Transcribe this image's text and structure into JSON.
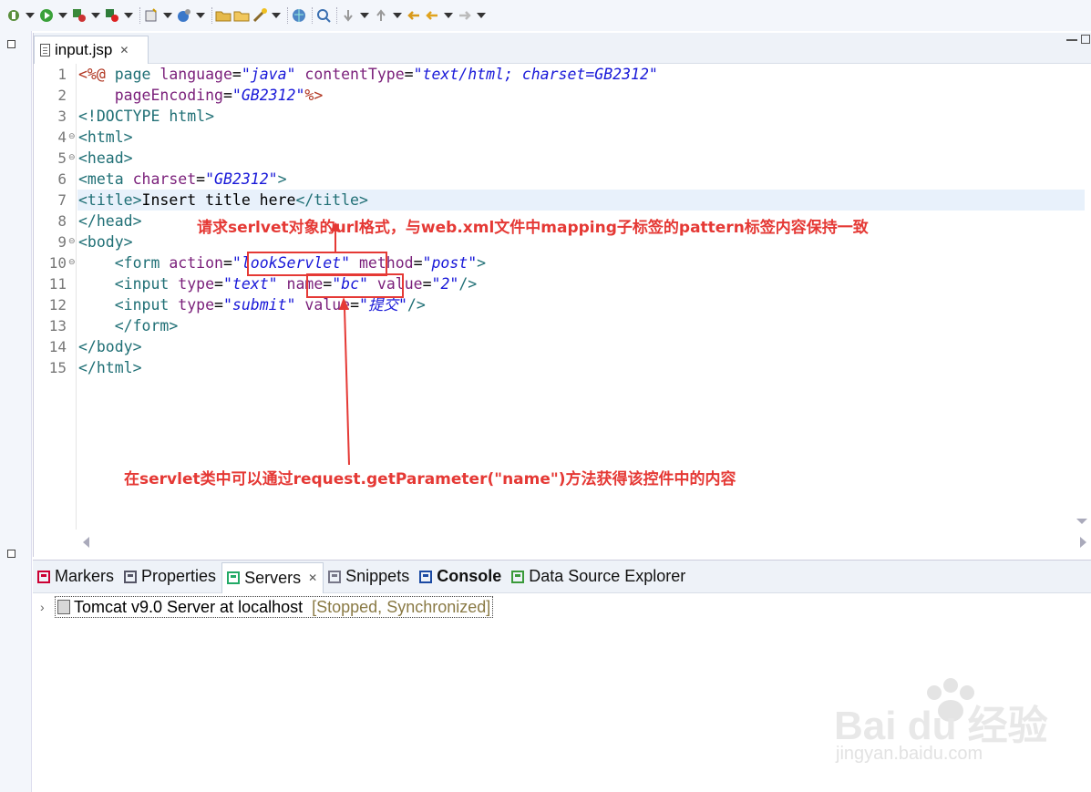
{
  "editor": {
    "tab_label": "input.jsp",
    "lines": [
      {
        "n": "1",
        "tokens": [
          {
            "c": "dl",
            "t": "<%@ "
          },
          {
            "c": "tg",
            "t": "page "
          },
          {
            "c": "an",
            "t": "language"
          },
          {
            "c": "tx",
            "t": "="
          },
          {
            "c": "av",
            "t": "\"java\""
          },
          {
            "c": "tx",
            "t": " "
          },
          {
            "c": "an",
            "t": "contentType"
          },
          {
            "c": "tx",
            "t": "="
          },
          {
            "c": "av",
            "t": "\"text/html; charset=GB2312\""
          }
        ]
      },
      {
        "n": "2",
        "tokens": [
          {
            "c": "tx",
            "t": "    "
          },
          {
            "c": "an",
            "t": "pageEncoding"
          },
          {
            "c": "tx",
            "t": "="
          },
          {
            "c": "av",
            "t": "\"GB2312\""
          },
          {
            "c": "dl",
            "t": "%>"
          }
        ]
      },
      {
        "n": "3",
        "tokens": [
          {
            "c": "tg",
            "t": "<!DOCTYPE "
          },
          {
            "c": "tg",
            "t": "html>"
          }
        ]
      },
      {
        "n": "4",
        "fold": true,
        "tokens": [
          {
            "c": "tg",
            "t": "<html>"
          }
        ]
      },
      {
        "n": "5",
        "fold": true,
        "tokens": [
          {
            "c": "tg",
            "t": "<head>"
          }
        ]
      },
      {
        "n": "6",
        "tokens": [
          {
            "c": "tg",
            "t": "<meta "
          },
          {
            "c": "an",
            "t": "charset"
          },
          {
            "c": "tx",
            "t": "="
          },
          {
            "c": "av",
            "t": "\"GB2312\""
          },
          {
            "c": "tg",
            "t": ">"
          }
        ]
      },
      {
        "n": "7",
        "tokens": [
          {
            "c": "tg",
            "t": "<title>"
          },
          {
            "c": "tx",
            "t": "Insert title here"
          },
          {
            "c": "tg",
            "t": "</title>"
          }
        ]
      },
      {
        "n": "8",
        "tokens": [
          {
            "c": "tg",
            "t": "</head>"
          }
        ]
      },
      {
        "n": "9",
        "fold": true,
        "tokens": [
          {
            "c": "tg",
            "t": "<body>"
          }
        ]
      },
      {
        "n": "10",
        "fold": true,
        "tokens": [
          {
            "c": "tx",
            "t": "    "
          },
          {
            "c": "tg",
            "t": "<form "
          },
          {
            "c": "an",
            "t": "action"
          },
          {
            "c": "tx",
            "t": "="
          },
          {
            "c": "av",
            "t": "\"lookServlet\""
          },
          {
            "c": "tx",
            "t": " "
          },
          {
            "c": "an",
            "t": "method"
          },
          {
            "c": "tx",
            "t": "="
          },
          {
            "c": "av",
            "t": "\"post\""
          },
          {
            "c": "tg",
            "t": ">"
          }
        ]
      },
      {
        "n": "11",
        "tokens": [
          {
            "c": "tx",
            "t": "    "
          },
          {
            "c": "tg",
            "t": "<input "
          },
          {
            "c": "an",
            "t": "type"
          },
          {
            "c": "tx",
            "t": "="
          },
          {
            "c": "av",
            "t": "\"text\""
          },
          {
            "c": "tx",
            "t": " "
          },
          {
            "c": "an",
            "t": "name"
          },
          {
            "c": "tx",
            "t": "="
          },
          {
            "c": "av",
            "t": "\"bc\""
          },
          {
            "c": "tx",
            "t": " "
          },
          {
            "c": "an",
            "t": "value"
          },
          {
            "c": "tx",
            "t": "="
          },
          {
            "c": "av",
            "t": "\"2\""
          },
          {
            "c": "tg",
            "t": "/>"
          }
        ]
      },
      {
        "n": "12",
        "tokens": [
          {
            "c": "tx",
            "t": "    "
          },
          {
            "c": "tg",
            "t": "<input "
          },
          {
            "c": "an",
            "t": "type"
          },
          {
            "c": "tx",
            "t": "="
          },
          {
            "c": "av",
            "t": "\"submit\""
          },
          {
            "c": "tx",
            "t": " "
          },
          {
            "c": "an",
            "t": "value"
          },
          {
            "c": "tx",
            "t": "="
          },
          {
            "c": "av",
            "t": "\"提交\""
          },
          {
            "c": "tg",
            "t": "/>"
          }
        ]
      },
      {
        "n": "13",
        "tokens": [
          {
            "c": "tx",
            "t": "    "
          },
          {
            "c": "tg",
            "t": "</form>"
          }
        ]
      },
      {
        "n": "14",
        "tokens": [
          {
            "c": "tg",
            "t": "</body>"
          }
        ]
      },
      {
        "n": "15",
        "tokens": [
          {
            "c": "tg",
            "t": "</html>"
          }
        ]
      }
    ]
  },
  "annotations": {
    "top": "请求serlvet对象的url格式，与web.xml文件中mapping子标签的pattern标签内容保持一致",
    "bottom": "在servlet类中可以通过request.getParameter(\"name\")方法获得该控件中的内容"
  },
  "bottom_tabs": [
    {
      "label": "Markers",
      "icon": "markers-icon"
    },
    {
      "label": "Properties",
      "icon": "properties-icon"
    },
    {
      "label": "Servers",
      "icon": "servers-icon",
      "active": true
    },
    {
      "label": "Snippets",
      "icon": "snippets-icon"
    },
    {
      "label": "Console",
      "icon": "console-icon",
      "bold": true
    },
    {
      "label": "Data Source Explorer",
      "icon": "data-source-icon"
    }
  ],
  "servers": {
    "name": "Tomcat v9.0 Server at localhost",
    "status": "[Stopped, Synchronized]"
  },
  "watermark": {
    "brand": "Bai du 经验",
    "url": "jingyan.baidu.com"
  },
  "colors": {
    "annotation": "#e53935",
    "tag": "#1f6f75",
    "attribute": "#7a1f7a",
    "value": "#1818d8"
  }
}
